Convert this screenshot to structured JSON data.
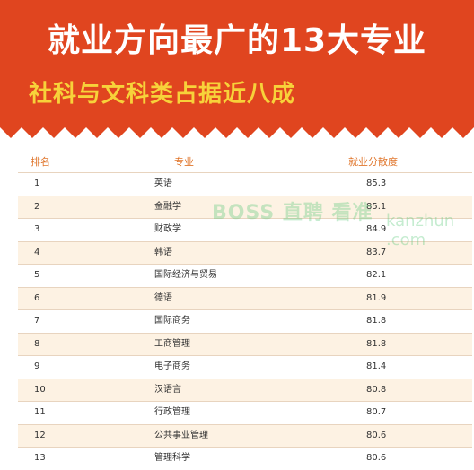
{
  "header": {
    "title": "就业方向最广的13大专业",
    "subtitle": "社科与文科类占据近八成",
    "colors": {
      "banner": "#e0451f",
      "subtitle": "#f7d23a",
      "header_text": "#e0762c",
      "alt_row": "#fdf2e3"
    }
  },
  "table": {
    "columns": [
      "排名",
      "专业",
      "就业分散度"
    ],
    "rows": [
      {
        "rank": "1",
        "major": "英语",
        "score": "85.3"
      },
      {
        "rank": "2",
        "major": "金融学",
        "score": "85.1"
      },
      {
        "rank": "3",
        "major": "财政学",
        "score": "84.9"
      },
      {
        "rank": "4",
        "major": "韩语",
        "score": "83.7"
      },
      {
        "rank": "5",
        "major": "国际经济与贸易",
        "score": "82.1"
      },
      {
        "rank": "6",
        "major": "德语",
        "score": "81.9"
      },
      {
        "rank": "7",
        "major": "国际商务",
        "score": "81.8"
      },
      {
        "rank": "8",
        "major": "工商管理",
        "score": "81.8"
      },
      {
        "rank": "9",
        "major": "电子商务",
        "score": "81.4"
      },
      {
        "rank": "10",
        "major": "汉语言",
        "score": "80.8"
      },
      {
        "rank": "11",
        "major": "行政管理",
        "score": "80.7"
      },
      {
        "rank": "12",
        "major": "公共事业管理",
        "score": "80.6"
      },
      {
        "rank": "13",
        "major": "管理科学",
        "score": "80.6"
      }
    ]
  },
  "watermark": {
    "text": "BOSS直聘 看准",
    "domain": "kanzhun .com"
  }
}
